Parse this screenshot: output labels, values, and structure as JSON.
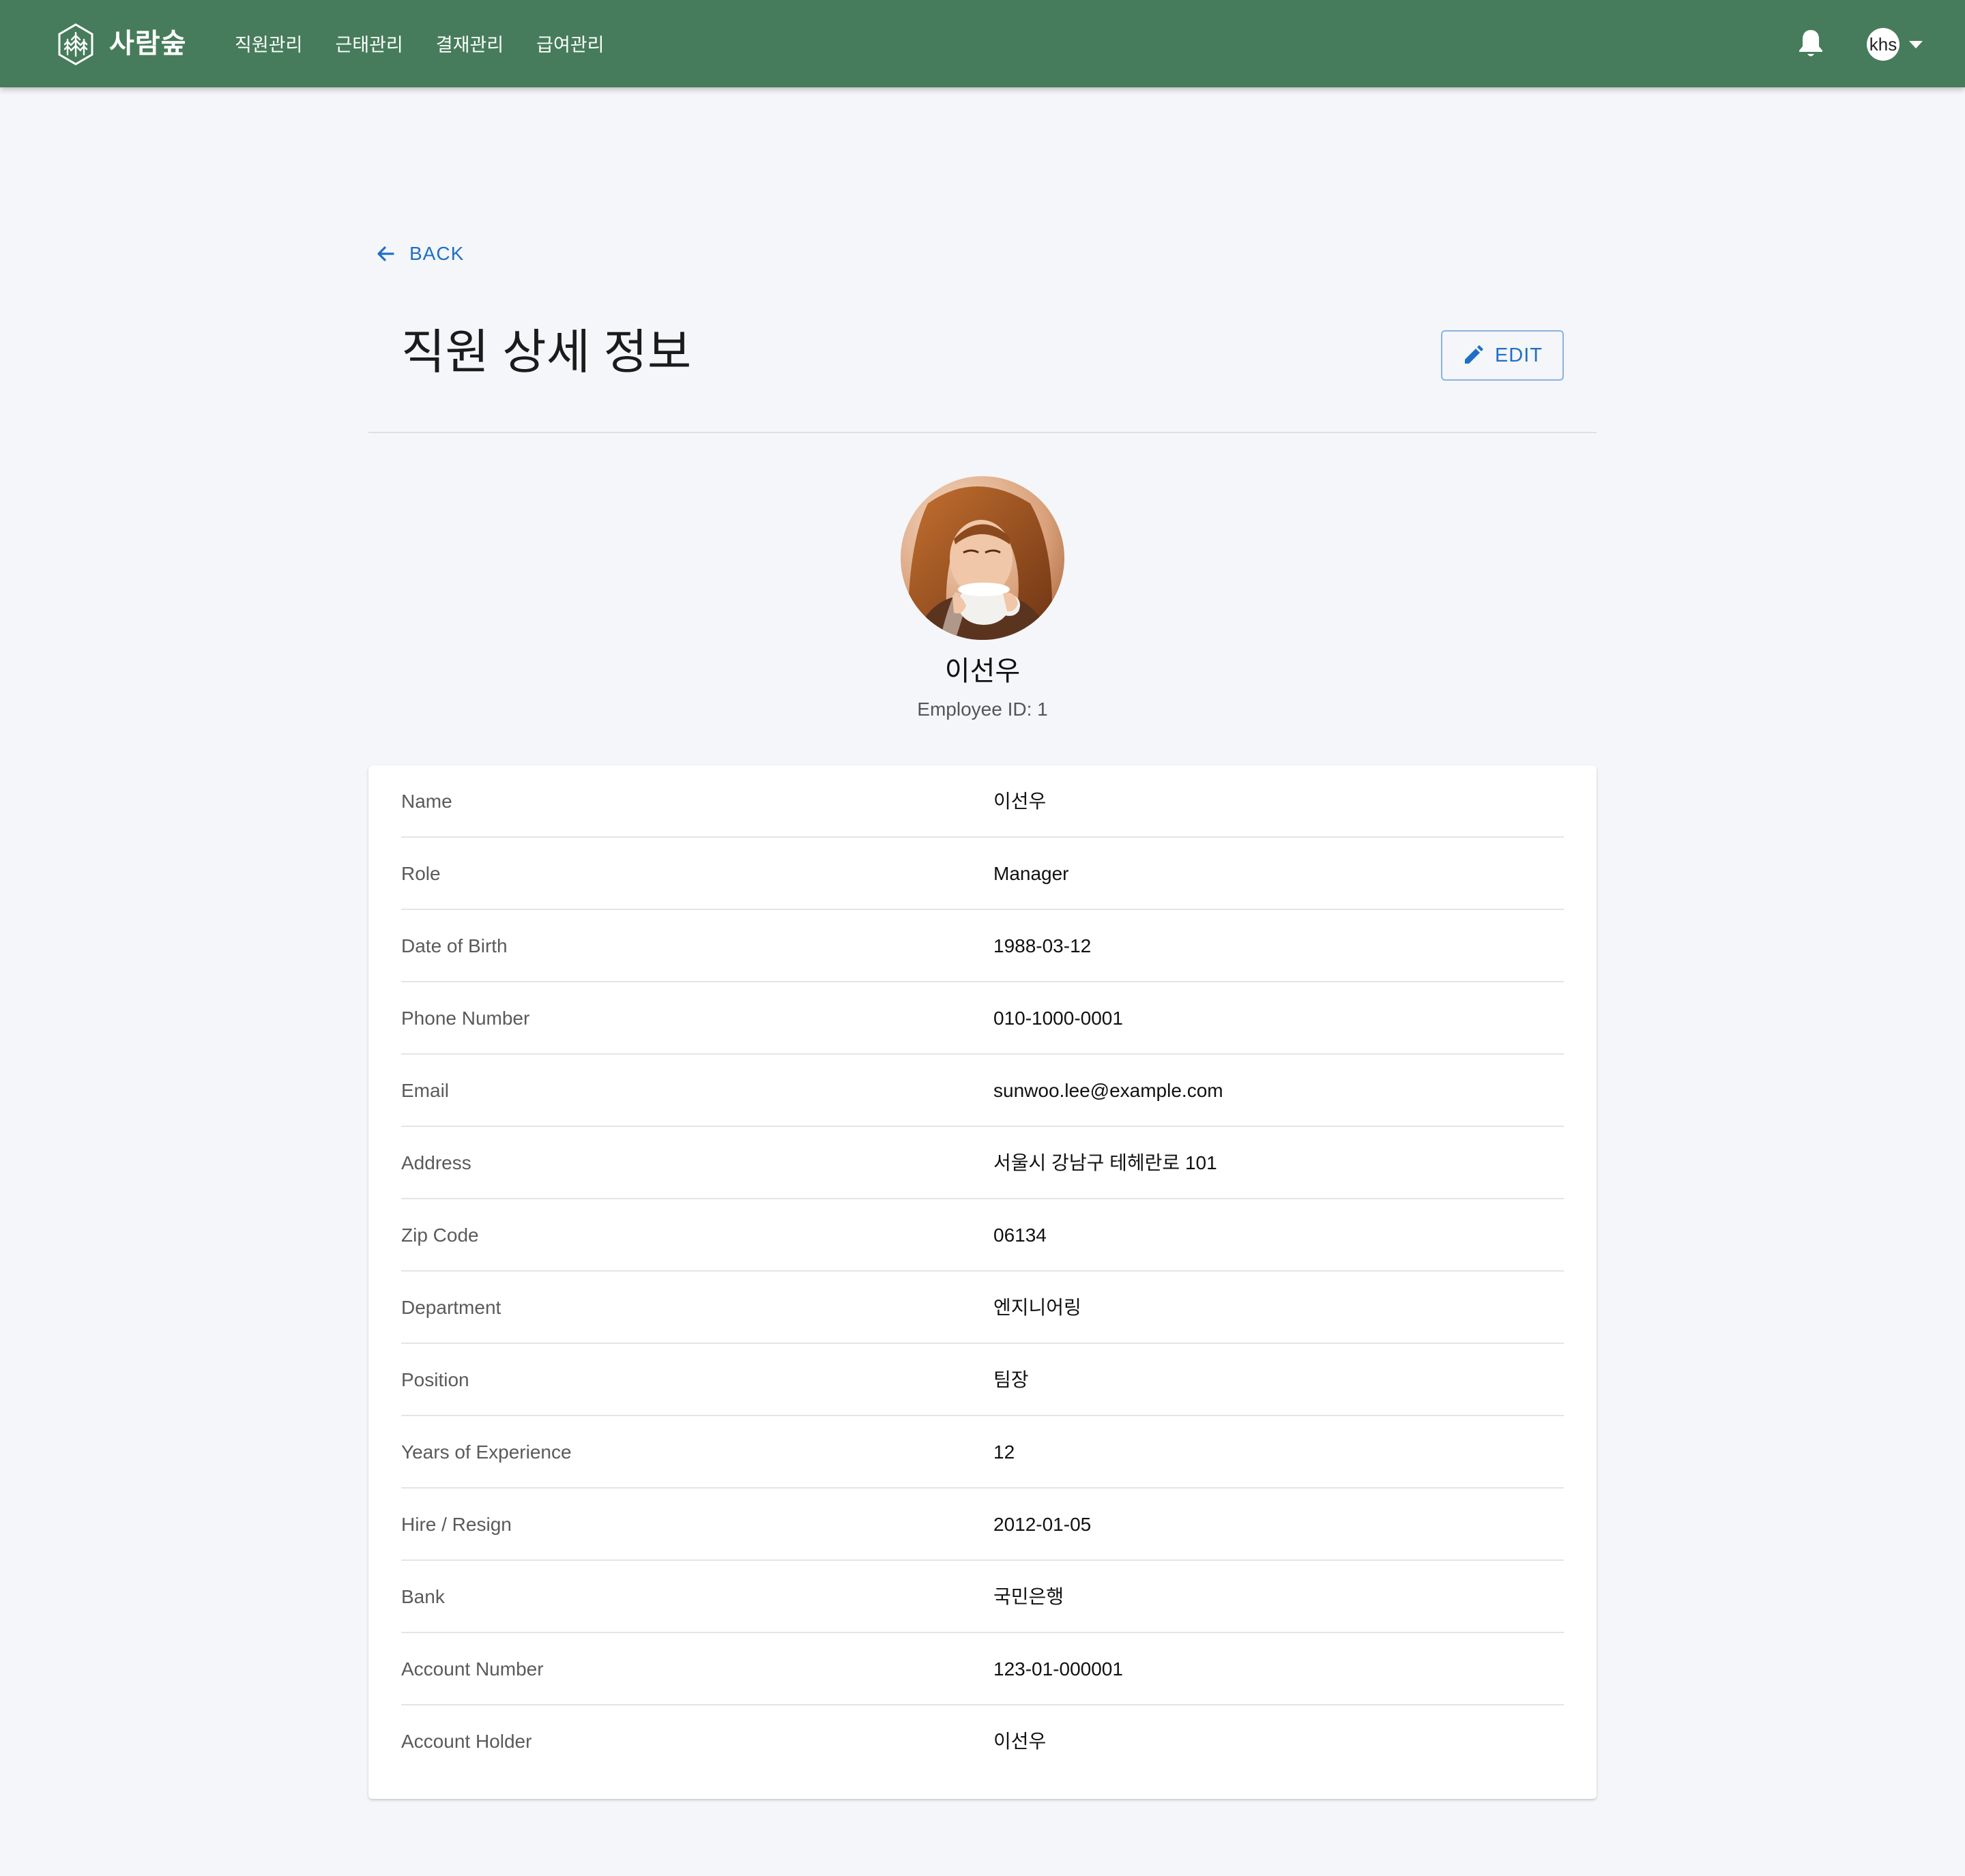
{
  "app": {
    "brand": "사람숲",
    "nav": [
      "직원관리",
      "근태관리",
      "결재관리",
      "급여관리"
    ],
    "user": "khs",
    "icons": {
      "logo": "forest-hexagon-icon",
      "notifications": "bell-icon",
      "menu": "caret-down-icon"
    }
  },
  "page": {
    "back_label": "BACK",
    "title": "직원 상세 정보",
    "edit_label": "EDIT",
    "icons": {
      "back": "arrow-left-icon",
      "edit": "pencil-icon"
    }
  },
  "profile": {
    "name": "이선우",
    "employee_id": "Employee ID: 1"
  },
  "details": [
    {
      "label": "Name",
      "value": "이선우"
    },
    {
      "label": "Role",
      "value": "Manager"
    },
    {
      "label": "Date of Birth",
      "value": "1988-03-12"
    },
    {
      "label": "Phone Number",
      "value": "010-1000-0001"
    },
    {
      "label": "Email",
      "value": "sunwoo.lee@example.com"
    },
    {
      "label": "Address",
      "value": "서울시 강남구 테헤란로 101"
    },
    {
      "label": "Zip Code",
      "value": "06134"
    },
    {
      "label": "Department",
      "value": "엔지니어링"
    },
    {
      "label": "Position",
      "value": "팀장"
    },
    {
      "label": "Years of Experience",
      "value": "12"
    },
    {
      "label": "Hire / Resign",
      "value": "2012-01-05"
    },
    {
      "label": "Bank",
      "value": "국민은행"
    },
    {
      "label": "Account Number",
      "value": "123-01-000001"
    },
    {
      "label": "Account Holder",
      "value": "이선우"
    }
  ],
  "colors": {
    "appbar": "#467c5b",
    "background": "#f4f6f9",
    "accent": "#1f6fc4"
  }
}
